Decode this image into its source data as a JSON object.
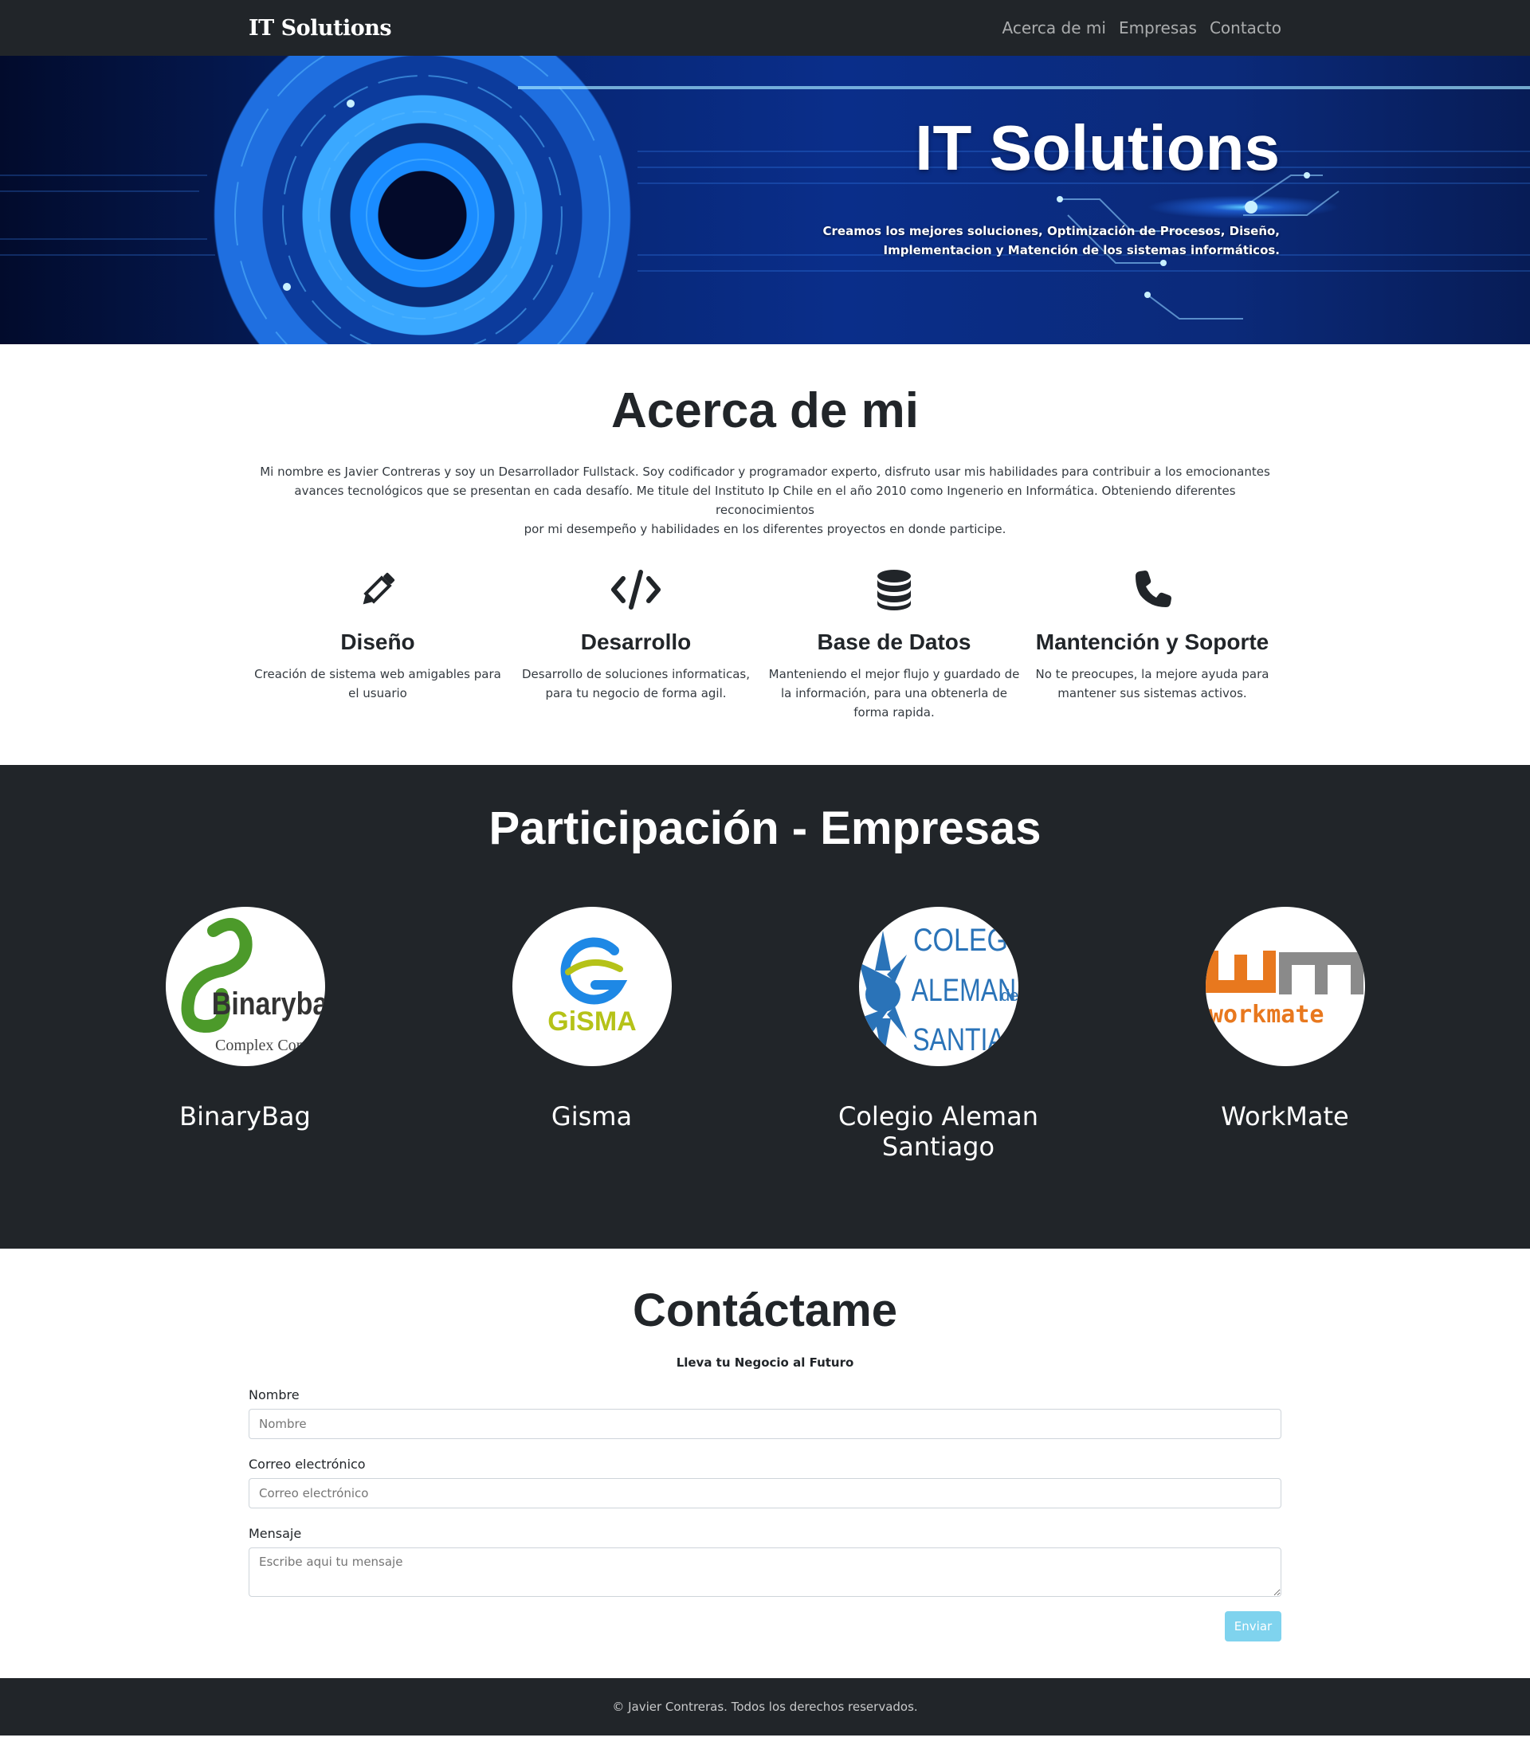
{
  "navbar": {
    "brand": "IT Solutions",
    "links": [
      "Acerca de mi",
      "Empresas",
      "Contacto"
    ]
  },
  "hero": {
    "title": "IT Solutions",
    "subtitle_line1": "Creamos los mejores soluciones, Optimización de Procesos, Diseño,",
    "subtitle_line2": "Implementacion y Matención de los sistemas informáticos."
  },
  "about": {
    "title": "Acerca de mi",
    "text_line1": "Mi nombre es Javier Contreras y soy un Desarrollador Fullstack. Soy codificador y programador experto, disfruto usar mis habilidades para contribuir a los emocionantes",
    "text_line2": "avances tecnológicos que se presentan en cada desafío. Me titule del Instituto Ip Chile en el año 2010 como Ingenerio en Informática. Obteniendo diferentes reconocimientos",
    "text_line3": "por mi desempeño y habilidades en los diferentes proyectos en donde participe.",
    "features": [
      {
        "icon": "pencil-icon",
        "title": "Diseño",
        "text": "Creación de sistema web amigables para el usuario"
      },
      {
        "icon": "code-icon",
        "title": "Desarrollo",
        "text": "Desarrollo de soluciones informaticas, para tu negocio de forma agil."
      },
      {
        "icon": "database-icon",
        "title": "Base de Datos",
        "text": "Manteniendo el mejor flujo y guardado de la información, para una obtenerla de forma rapida."
      },
      {
        "icon": "phone-icon",
        "title": "Mantención y Soporte",
        "text": "No te preocupes, la mejore ayuda para mantener sus sistemas activos."
      }
    ]
  },
  "companies": {
    "title": "Participación - Empresas",
    "items": [
      {
        "name": "BinaryBag",
        "logo_text_1": "Binarybag",
        "logo_text_2": "Complex Compu"
      },
      {
        "name": "Gisma",
        "logo_text_1": "GiSMA"
      },
      {
        "name_line1": "Colegio Aleman",
        "name_line2": "Santiago",
        "logo_text_1": "COLEGIO",
        "logo_text_2": "ALEMAN",
        "logo_text_3": "SANTIAGO",
        "logo_text_de": "de"
      },
      {
        "name": "WorkMate",
        "logo_text_1": "wm",
        "logo_text_2": "workmate"
      }
    ]
  },
  "contact": {
    "title": "Contáctame",
    "lead": "Lleva tu Negocio al Futuro",
    "fields": {
      "name_label": "Nombre",
      "name_placeholder": "Nombre",
      "email_label": "Correo electrónico",
      "email_placeholder": "Correo electrónico",
      "message_label": "Mensaje",
      "message_placeholder": "Escribe aqui tu mensaje"
    },
    "submit_label": "Enviar"
  },
  "footer": {
    "text": "© Javier Contreras. Todos los derechos reservados."
  },
  "colors": {
    "dark": "#212529",
    "button": "#7fd3ee",
    "binarybag_green": "#4c9a2a",
    "gisma_blue": "#1e88e5",
    "gisma_yellow": "#b5c218",
    "colegio_blue": "#2a73b8",
    "workmate_orange": "#e8781e",
    "workmate_gray": "#8a8a8a"
  }
}
